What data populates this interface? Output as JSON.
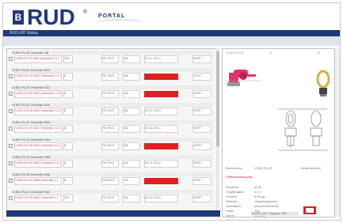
{
  "header": {
    "logo_initial": "B",
    "brand": "RUD",
    "registered": "®",
    "portal": "PORTAL"
  },
  "nav": {
    "breadcrumb": "RUD-VIP Status"
  },
  "list": {
    "items": [
      {
        "title": "VLBG-PLUS Gewinde M8",
        "name": "VLBG-PLUS M8 Gewinde 0,3 t",
        "qty": "200",
        "unit": "Stk",
        "code": "PK-RUD",
        "status_text": "03.11.2014",
        "ext": "SHIFT",
        "red": false
      },
      {
        "title": "VLBG-PLUS Gewinde M10",
        "name": "VLBG-PLUS M10 Gewinde 0,4 t",
        "qty": "8",
        "unit": "Stk",
        "code": "PK-RUD",
        "status_text": "",
        "ext": "SHIFT",
        "red": true
      },
      {
        "title": "VLBG-PLUS Gewinde M12",
        "name": "VLBG-PLUS M12 Gewinde 0,75 t",
        "qty": "8",
        "unit": "Stk",
        "code": "PK-RUD",
        "status_text": "",
        "ext": "SHIFT",
        "red": true
      },
      {
        "title": "VLBG-PLUS Gewinde M16",
        "name": "VLBG-PLUS M16 Gewinde 1,5 t",
        "qty": "8",
        "unit": "Stk",
        "code": "PK-RUD",
        "status_text": "03.11.2014",
        "ext": "SHIFT",
        "red": false
      },
      {
        "title": "VLBG-PLUS Gewinde M20",
        "name": "VLBG-PLUS M20 Gewinde 2,3 t",
        "qty": "8",
        "unit": "Stk",
        "code": "PK-RUD",
        "status_text": "04.11.2014",
        "ext": "SHIFT",
        "red": false
      },
      {
        "title": "VLBG-PLUS Gewinde M24",
        "name": "VLBG-PLUS M24 Gewinde 3,2 t",
        "qty": "8",
        "unit": "Stk",
        "code": "PK-RUD",
        "status_text": "",
        "ext": "SHIFT",
        "red": true
      },
      {
        "title": "VLBG-PLUS Gewinde M30",
        "name": "VLBG-PLUS M30 Gewinde 4,5 t",
        "qty": "8",
        "unit": "Stk",
        "code": "PK-RUD",
        "status_text": "05.11.2014",
        "ext": "SHIFT",
        "red": false
      },
      {
        "title": "VLBG-PLUS Gewinde M36",
        "name": "VLBG-PLUS M36 Gewinde 7 t",
        "qty": "8",
        "unit": "Stk",
        "code": "PK-RUD",
        "status_text": "",
        "ext": "SHIFT",
        "red": true
      },
      {
        "title": "VLBG-PLUS Gewinde M42",
        "name": "VLBG-PLUS M42 Gewinde 9 t",
        "qty": "200",
        "unit": "Stk",
        "code": "PK-RUD",
        "status_text": "06.11.2014",
        "ext": "SHIFT",
        "red": false
      }
    ]
  },
  "detail": {
    "title": "VLBG-PLUS",
    "dim_a": "A",
    "dim_b": "B",
    "highlight": "Prüfbescheinigung",
    "specs": [
      {
        "k": "Benennung",
        "v": "VLBG-PLUS",
        "v2": "Gewindegröße"
      },
      {
        "k": "Gewinde",
        "v": "M 20",
        "v2": ""
      },
      {
        "k": "Tragfähigkeit",
        "v": "2,5 t",
        "v2": ""
      },
      {
        "k": "Gewicht",
        "v": "0,95 kg",
        "v2": ""
      },
      {
        "k": "Material",
        "v": "Vergütungsstahl",
        "v2": ""
      },
      {
        "k": "Oberfläche",
        "v": "pulverbeschichtet",
        "v2": ""
      },
      {
        "k": "Farbe",
        "v": "pink",
        "v2": ""
      },
      {
        "k": "Norm",
        "v": "EN 1677",
        "v2": ""
      },
      {
        "k": "Sicherheit",
        "v": "4:1",
        "v2": ""
      }
    ],
    "footer": "Drehbar 360° / klappbar 180°"
  },
  "colors": {
    "brand": "#1e3a7a",
    "red": "#e02020",
    "pink": "#e0356a",
    "gold": "#d8b040"
  }
}
